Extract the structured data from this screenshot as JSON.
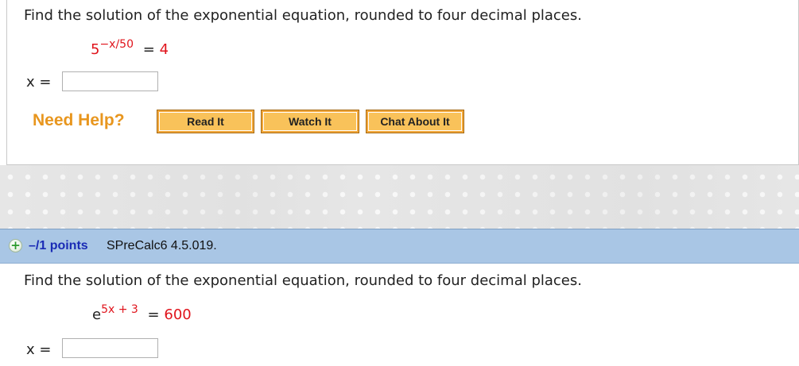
{
  "question1": {
    "prompt": "Find the solution of the exponential equation, rounded to four decimal places.",
    "equation_base": "5",
    "equation_exponent": "−x/50",
    "equation_equals": "=",
    "equation_rhs": "4",
    "answer_label": "x =",
    "answer_value": ""
  },
  "help": {
    "need_help_label": "Need Help?",
    "read_it_label": "Read It",
    "watch_it_label": "Watch It",
    "chat_about_it_label": "Chat About It"
  },
  "question2": {
    "expand_icon": "plus-icon",
    "points_label": "–/1 points",
    "question_id": "SPreCalc6 4.5.019.",
    "prompt": "Find the solution of the exponential equation, rounded to four decimal places.",
    "equation_base": "e",
    "equation_exponent": "5x + 3",
    "equation_equals": "=",
    "equation_rhs": "600",
    "answer_label": "x =",
    "answer_value": ""
  },
  "colors": {
    "accent_orange": "#e8961e",
    "button_orange": "#f3a83b",
    "header_blue": "#a9c6e5",
    "points_blue": "#1a2bb5",
    "equation_red": "#e0141c"
  }
}
